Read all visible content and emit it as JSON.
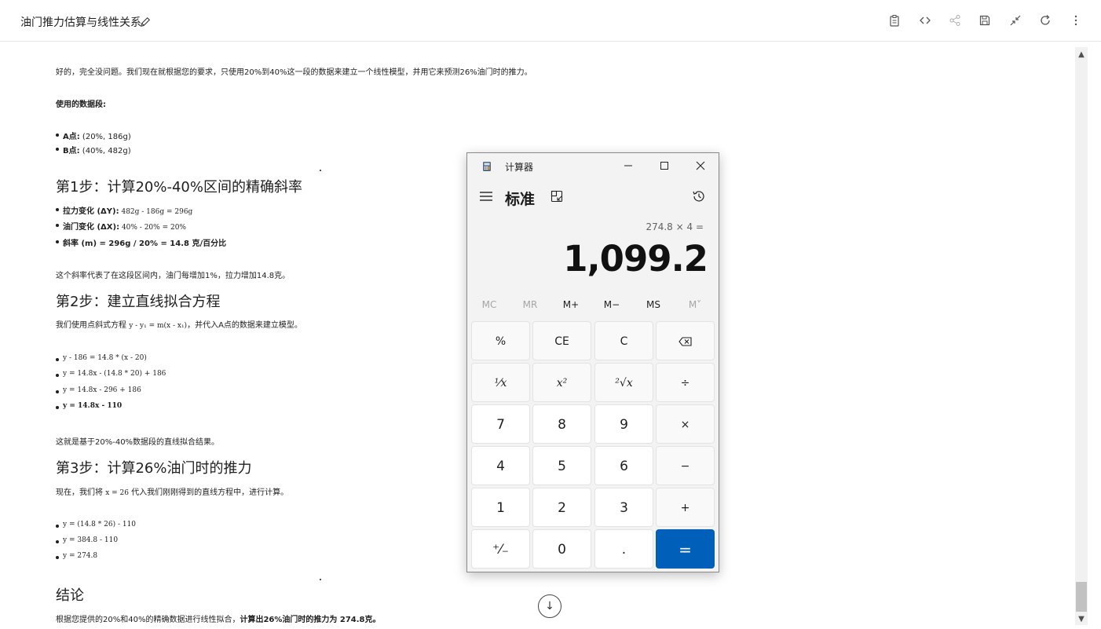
{
  "header": {
    "title": "油门推力估算与线性关系"
  },
  "content": {
    "intro": "好的，完全没问题。我们现在就根据您的要求，只使用20%到40%这一段的数据来建立一个线性模型，并用它来预测26%油门时的推力。",
    "data_heading": "使用的数据段:",
    "points": [
      {
        "label": "A点:",
        "value": " (20%, 186g)"
      },
      {
        "label": "B点:",
        "value": " (40%, 482g)"
      }
    ],
    "step1": {
      "title": "第1步：计算20%-40%区间的精确斜率",
      "items": [
        {
          "label": "拉力变化 (ΔY):",
          "value": " 482g - 186g = 296g"
        },
        {
          "label": "油门变化 (ΔX):",
          "value": " 40% - 20% = 20%"
        },
        {
          "label": "斜率 (m) = 296g / 20% = 14.8 克/百分比",
          "value": ""
        }
      ],
      "note": "这个斜率代表了在这段区间内，油门每增加1%，拉力增加14.8克。"
    },
    "step2": {
      "title": "第2步：建立直线拟合方程",
      "intro_a": "我们使用点斜式方程 ",
      "formula": "y - y₁ = m(x - x₁)",
      "intro_b": "，并代入A点的数据来建立模型。",
      "items": [
        "y - 186 = 14.8 * (x - 20)",
        "y = 14.8x - (14.8 * 20) + 186",
        "y = 14.8x - 296 + 186",
        "y = 14.8x - 110"
      ],
      "note": "这就是基于20%-40%数据段的直线拟合结果。"
    },
    "step3": {
      "title": "第3步：计算26%油门时的推力",
      "intro_a": "现在，我们将 ",
      "formula": "x = 26",
      "intro_b": " 代入我们刚刚得到的直线方程中，进行计算。",
      "items": [
        "y = (14.8 * 26) - 110",
        "y = 384.8 - 110",
        "y = 274.8"
      ]
    },
    "conclusion": {
      "title": "结论",
      "text_a": "根据您提供的20%和40%的精确数据进行线性拟合，",
      "text_b": "计算出26%油门时的推力为 274.8克。"
    }
  },
  "calculator": {
    "window_title": "计算器",
    "mode": "标准",
    "expression": "274.8 × 4 =",
    "result": "1,099.2",
    "memory": [
      "MC",
      "MR",
      "M+",
      "M−",
      "MS",
      "M˅"
    ],
    "memory_enabled": [
      false,
      false,
      true,
      true,
      true,
      false
    ],
    "keys": {
      "percent": "%",
      "ce": "CE",
      "c": "C",
      "backspace": "⌫",
      "reciprocal": "¹⁄x",
      "square": "x²",
      "sqrt": "²√x",
      "divide": "÷",
      "seven": "7",
      "eight": "8",
      "nine": "9",
      "multiply": "×",
      "four": "4",
      "five": "5",
      "six": "6",
      "minus": "−",
      "one": "1",
      "two": "2",
      "three": "3",
      "plus": "+",
      "negate": "⁺⁄₋",
      "zero": "0",
      "decimal": ".",
      "equals": "="
    }
  },
  "colors": {
    "accent": "#005fb8",
    "text": "#1f1f1f"
  }
}
